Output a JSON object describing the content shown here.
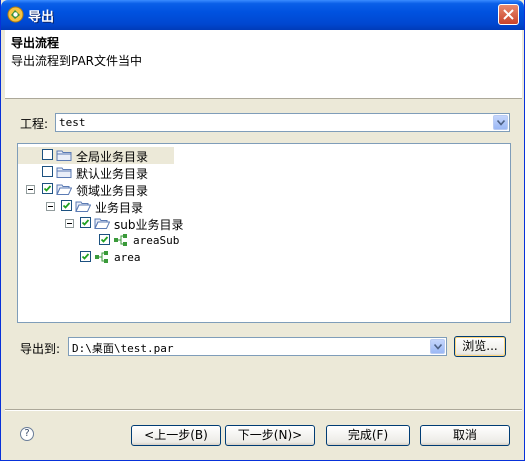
{
  "window": {
    "title": "导出",
    "accent": "#0052e0"
  },
  "header": {
    "title": "导出流程",
    "description": "导出流程到PAR文件当中"
  },
  "project": {
    "label": "工程:",
    "value": "test"
  },
  "tree": {
    "nodes": [
      {
        "label": "全局业务目录",
        "checked": false,
        "expanded": null,
        "icon": "folder-icon",
        "selected": true
      },
      {
        "label": "默认业务目录",
        "checked": false,
        "expanded": null,
        "icon": "folder-icon"
      },
      {
        "label": "领域业务目录",
        "checked": true,
        "expanded": true,
        "icon": "folder-icon"
      },
      {
        "label": "业务目录",
        "checked": true,
        "expanded": true,
        "icon": "folder-icon"
      },
      {
        "label": "sub业务目录",
        "checked": true,
        "expanded": true,
        "icon": "folder-icon"
      },
      {
        "label": "areaSub",
        "checked": true,
        "expanded": null,
        "icon": "process-icon"
      },
      {
        "label": "area",
        "checked": true,
        "expanded": null,
        "icon": "process-icon"
      }
    ]
  },
  "export_to": {
    "label": "导出到:",
    "value": "D:\\桌面\\test.par",
    "browse_label": "浏览..."
  },
  "footer": {
    "help_icon": "help-icon",
    "back_label": "<上一步(B)",
    "next_label": "下一步(N)>",
    "finish_label": "完成(F)",
    "cancel_label": "取消"
  }
}
